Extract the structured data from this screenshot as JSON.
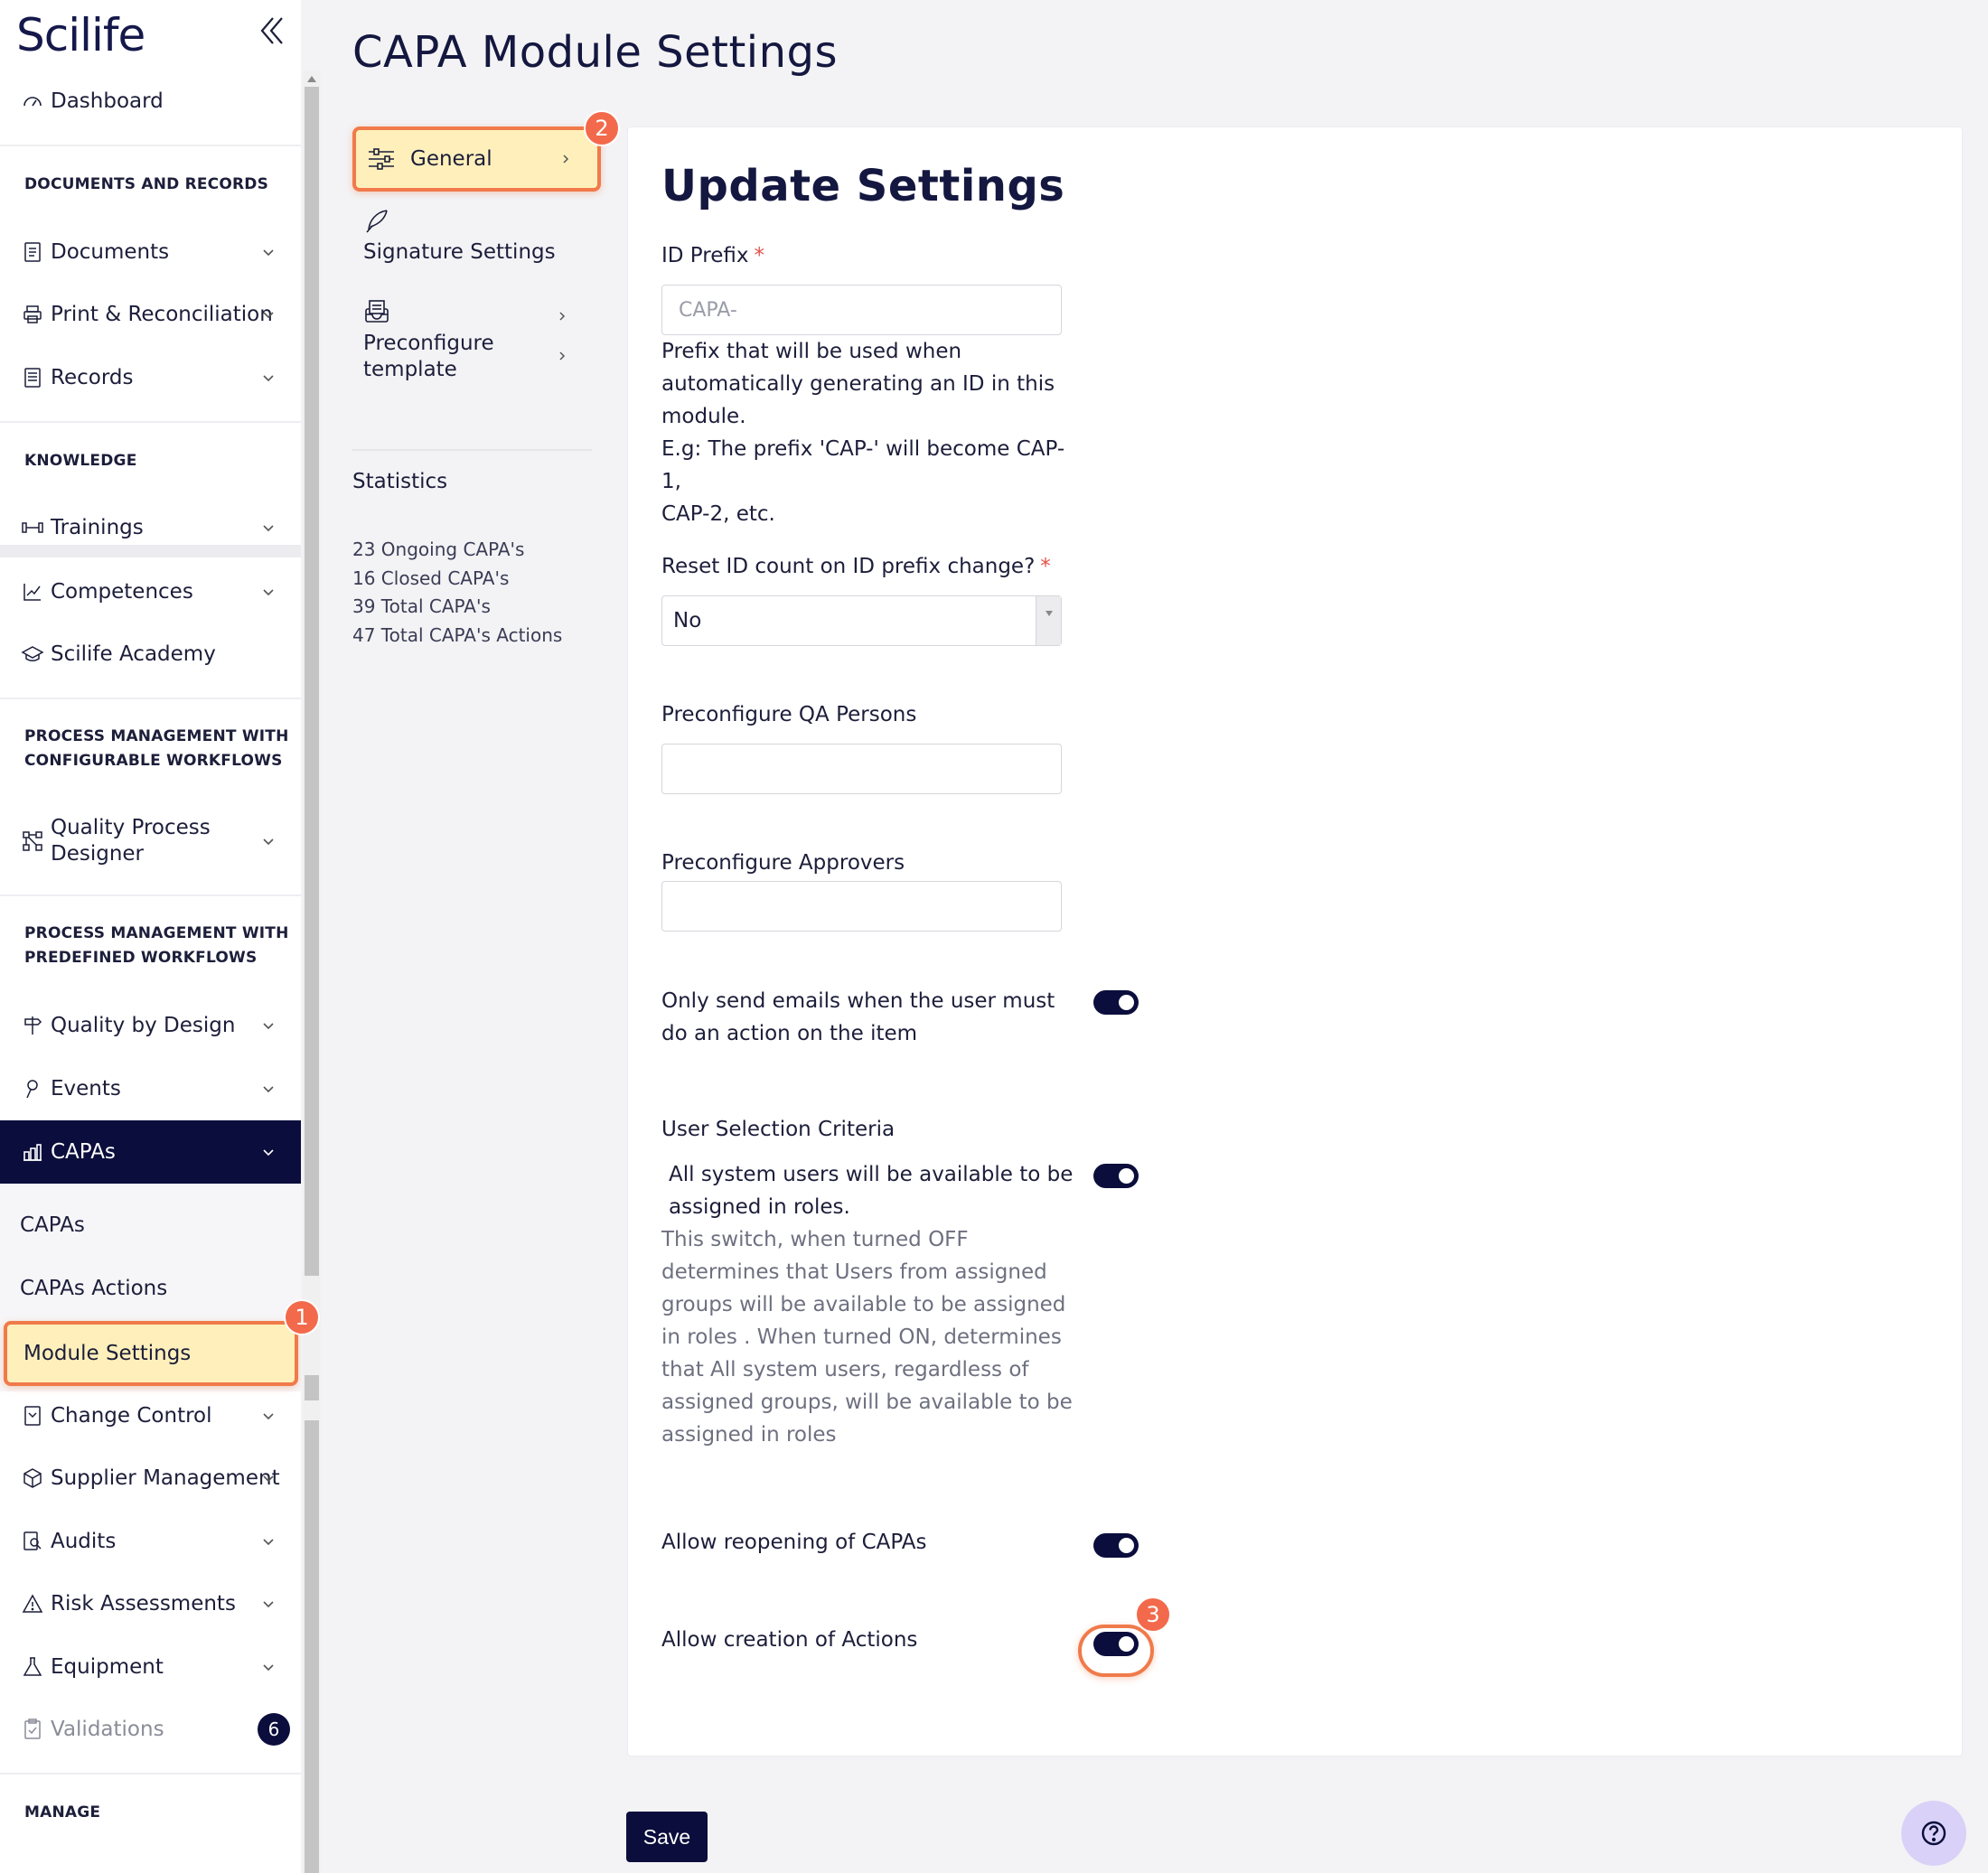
{
  "brand": {
    "logo": "Scilife"
  },
  "sidebar": {
    "dashboard": "Dashboard",
    "sections": {
      "documents": "DOCUMENTS AND RECORDS",
      "knowledge": "KNOWLEDGE",
      "configurable_1": "PROCESS MANAGEMENT WITH",
      "configurable_2": "CONFIGURABLE WORKFLOWS",
      "predefined_1": "PROCESS MANAGEMENT WITH",
      "predefined_2": "PREDEFINED WORKFLOWS",
      "manage": "MANAGE"
    },
    "items": {
      "documents": "Documents",
      "print": "Print & Reconciliation",
      "records": "Records",
      "trainings": "Trainings",
      "competences": "Competences",
      "academy": "Scilife Academy",
      "qpd_1": "Quality Process",
      "qpd_2": "Designer",
      "qbd": "Quality by Design",
      "events": "Events",
      "capas": "CAPAs",
      "change_control": "Change Control",
      "supplier": "Supplier Management",
      "audits": "Audits",
      "risk": "Risk Assessments",
      "equipment": "Equipment",
      "validations": "Validations"
    },
    "capa_sub": {
      "capas": "CAPAs",
      "actions": "CAPAs Actions",
      "module_settings": "Module Settings"
    },
    "validations_badge": "6"
  },
  "markers": {
    "one": "1",
    "two": "2",
    "three": "3"
  },
  "main": {
    "title": "CAPA Module Settings",
    "nav": {
      "general": "General",
      "signature": "Signature Settings",
      "preconfigure_1": "Preconfigure",
      "preconfigure_2": "template"
    },
    "stats": {
      "title": "Statistics",
      "ongoing": "23 Ongoing CAPA's",
      "closed": "16 Closed CAPA's",
      "total": "39 Total CAPA's",
      "actions": "47 Total CAPA's Actions"
    }
  },
  "form": {
    "title": "Update Settings",
    "id_prefix": {
      "label": "ID Prefix",
      "required": "*",
      "value": "CAPA-",
      "help": [
        "Prefix that will be used when",
        "automatically generating an ID in this",
        "module.",
        "E.g: The prefix 'CAP-' will become CAP-1,",
        "CAP-2, etc."
      ]
    },
    "reset_count": {
      "label": "Reset ID count on ID prefix change?",
      "required": "*",
      "value": "No"
    },
    "qa_persons": {
      "label": "Preconfigure QA Persons",
      "value": ""
    },
    "approvers": {
      "label": "Preconfigure Approvers",
      "value": ""
    },
    "emails_toggle": {
      "label_1": "Only send emails when the user must",
      "label_2": "do an action on the item",
      "on": true
    },
    "user_selection": {
      "label": "User Selection Criteria",
      "toggle_label_1": "All system users will be available to be",
      "toggle_label_2": "assigned in roles.",
      "on": true,
      "description": [
        "This switch, when turned OFF",
        "determines that Users from assigned",
        "groups will be available to be assigned",
        "in roles . When turned ON, determines",
        "that All system users, regardless of",
        "assigned groups, will be available to be",
        "assigned in roles"
      ]
    },
    "reopening": {
      "label": "Allow reopening of CAPAs",
      "on": true
    },
    "creation": {
      "label": "Allow creation of Actions",
      "on": true
    },
    "save": "Save"
  },
  "colors": {
    "brand_navy": "#0b0e3c",
    "highlight": "#fff0bb",
    "marker": "#f26a4b",
    "required": "#e3524b"
  }
}
